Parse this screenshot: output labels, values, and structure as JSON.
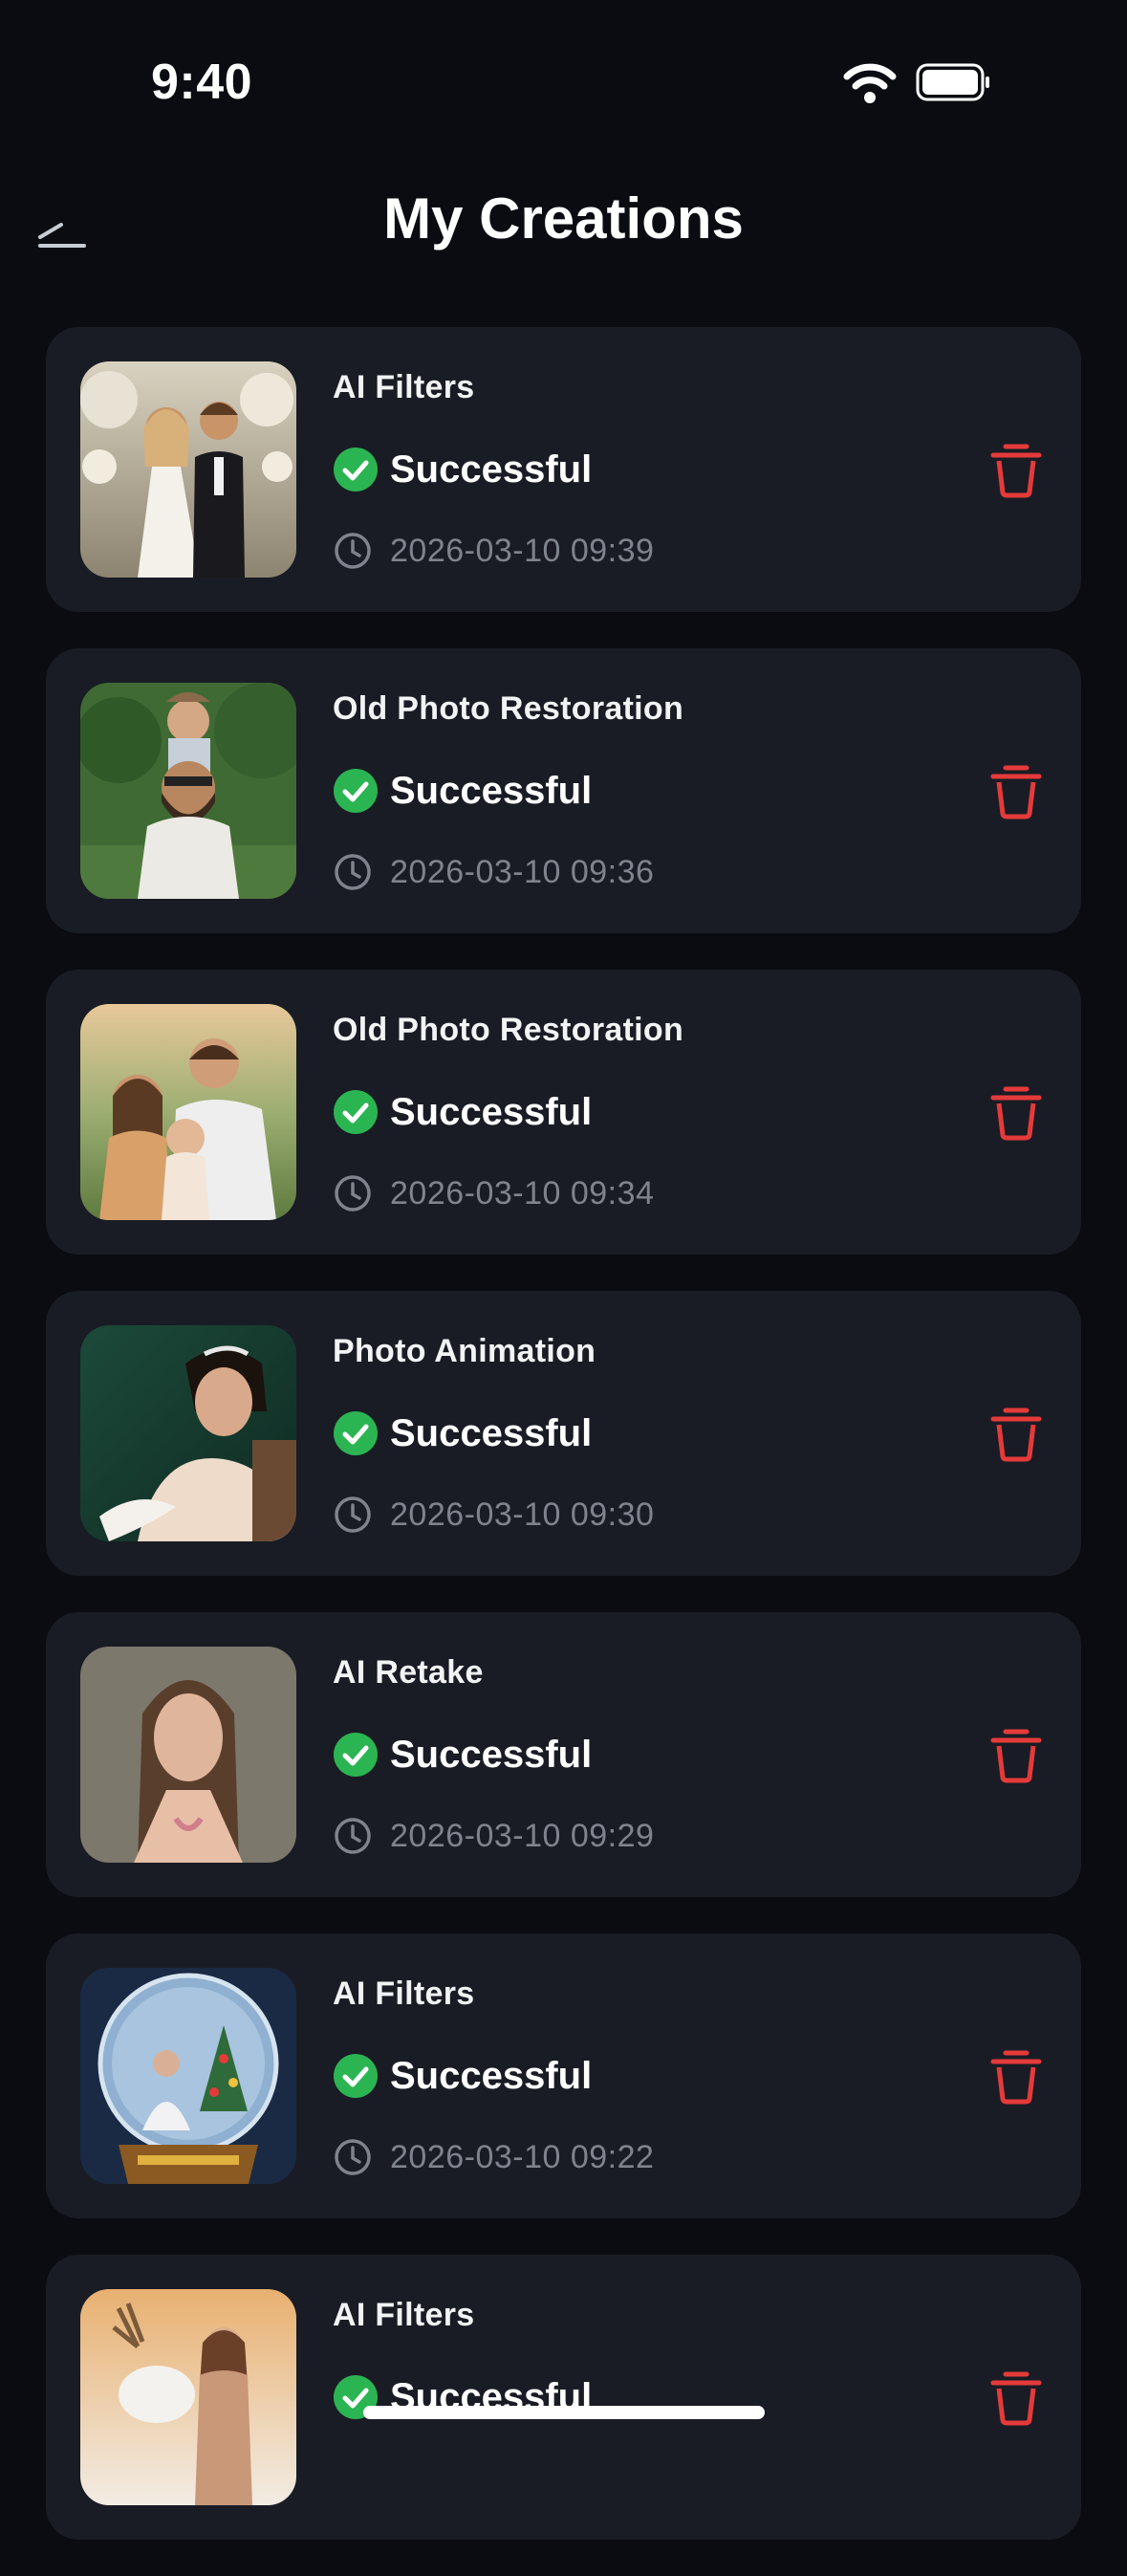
{
  "status_bar": {
    "time": "9:40"
  },
  "header": {
    "title": "My Creations"
  },
  "colors": {
    "background": "#0a0c12",
    "card": "#191c24",
    "success_green": "#2bb552",
    "delete_red": "#e53a3a",
    "muted_text": "#7e838d"
  },
  "creations": [
    {
      "title": "AI Filters",
      "status": "Successful",
      "time": "2026-03-10 09:39",
      "thumb": "wedding-couple-photo"
    },
    {
      "title": "Old Photo Restoration",
      "status": "Successful",
      "time": "2026-03-10 09:36",
      "thumb": "father-child-photo"
    },
    {
      "title": "Old Photo Restoration",
      "status": "Successful",
      "time": "2026-03-10 09:34",
      "thumb": "family-photo"
    },
    {
      "title": "Photo Animation",
      "status": "Successful",
      "time": "2026-03-10 09:30",
      "thumb": "bride-portrait-photo"
    },
    {
      "title": "AI Retake",
      "status": "Successful",
      "time": "2026-03-10 09:29",
      "thumb": "woman-portrait-photo"
    },
    {
      "title": "AI Filters",
      "status": "Successful",
      "time": "2026-03-10 09:22",
      "thumb": "snow-globe-photo"
    },
    {
      "title": "AI Filters",
      "status": "Successful",
      "time": "",
      "thumb": "reindeer-woman-photo"
    }
  ]
}
